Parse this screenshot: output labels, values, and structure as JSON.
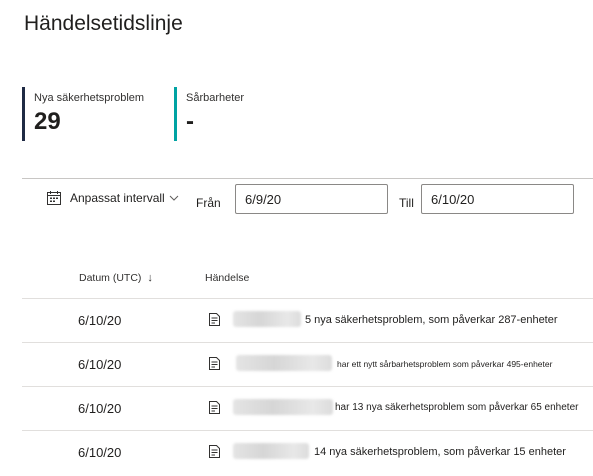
{
  "page": {
    "title": "Händelsetidslinje"
  },
  "stats": [
    {
      "label": "Nya säkerhetsproblem",
      "value": "29",
      "color": "#1f2a44"
    },
    {
      "label": "Sårbarheter",
      "value": "-",
      "color": "#00a3a3"
    }
  ],
  "filter": {
    "range_label": "Anpassat intervall",
    "from_label": "Från",
    "from_value": "6/9/20",
    "to_label": "Till",
    "to_value": "6/10/20"
  },
  "table": {
    "columns": [
      "Datum (UTC)",
      "Händelse"
    ],
    "sort_icon": "arrow-down-icon",
    "rows": [
      {
        "date": "6/10/20",
        "event": "5 nya säkerhetsproblem, som påverkar 287-enheter"
      },
      {
        "date": "6/10/20",
        "event": "har ett nytt sårbarhetsproblem som påverkar 495-enheter"
      },
      {
        "date": "6/10/20",
        "event": "har 13 nya säkerhetsproblem som påverkar 65 enheter"
      },
      {
        "date": "6/10/20",
        "event": "14 nya säkerhetsproblem, som påverkar 15 enheter"
      }
    ]
  }
}
